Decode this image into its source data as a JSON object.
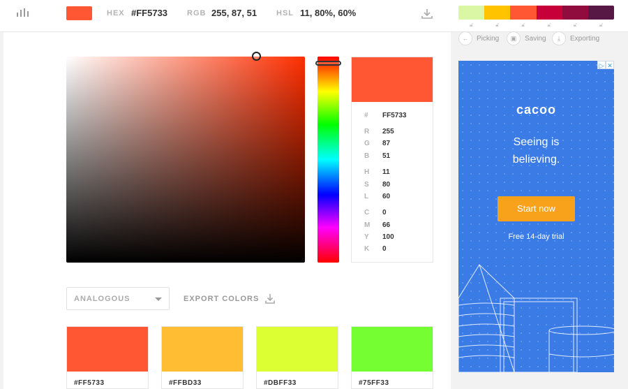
{
  "topbar": {
    "hex_label": "HEX",
    "hex_value": "#FF5733",
    "rgb_label": "RGB",
    "rgb_value": "255, 87, 51",
    "hsl_label": "HSL",
    "hsl_value": "11, 80%, 60%",
    "current_color": "#FF5733"
  },
  "history": {
    "colors": [
      "#DAF7A6",
      "#FFC300",
      "#FF5733",
      "#C70039",
      "#900C3F",
      "#581845"
    ]
  },
  "features": {
    "picking": "Picking",
    "saving": "Saving",
    "exporting": "Exporting"
  },
  "social": [
    "twitter-icon",
    "facebook-icon",
    "google-plus-icon",
    "pinterest-icon"
  ],
  "picker": {
    "hue_color": "#FF2E00"
  },
  "info": {
    "hash_label": "#",
    "hex": "FF5733",
    "r_label": "R",
    "r": "255",
    "g_label": "G",
    "g": "87",
    "b_label": "B",
    "b": "51",
    "h_label": "H",
    "h": "11",
    "s_label": "S",
    "s": "80",
    "l_label": "L",
    "l": "60",
    "c_label": "C",
    "c": "0",
    "m_label": "M",
    "m": "66",
    "y_label": "Y",
    "y": "100",
    "k_label": "K",
    "k": "0"
  },
  "scheme": {
    "selected": "ANALOGOUS",
    "export_label": "EXPORT COLORS"
  },
  "palette": [
    {
      "hex": "#FF5733",
      "color": "#FF5733"
    },
    {
      "hex": "#FFBD33",
      "color": "#FFBD33"
    },
    {
      "hex": "#DBFF33",
      "color": "#DBFF33"
    },
    {
      "hex": "#75FF33",
      "color": "#75FF33"
    }
  ],
  "ad": {
    "logo": "cacoo",
    "headline_1": "Seeing is",
    "headline_2": "believing.",
    "cta": "Start now",
    "trial": "Free 14-day trial"
  }
}
